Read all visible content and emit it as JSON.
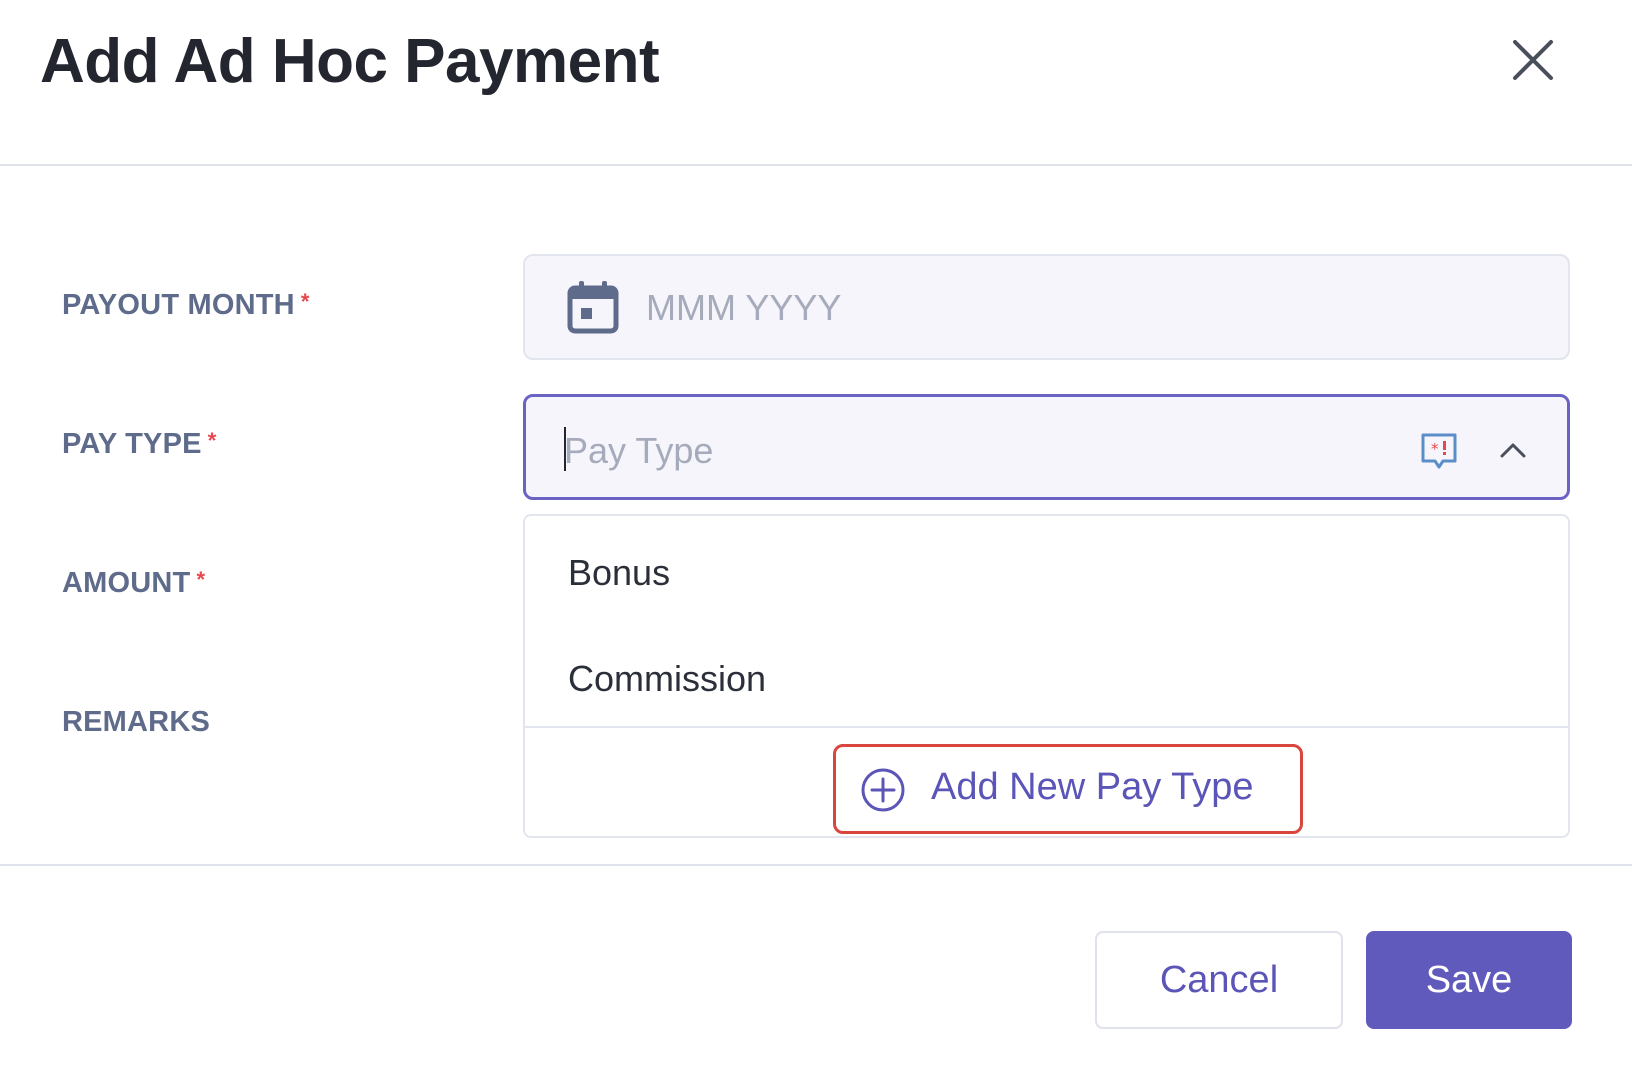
{
  "dialog": {
    "title": "Add Ad Hoc Payment"
  },
  "form": {
    "payout_month": {
      "label": "PAYOUT MONTH",
      "required_mark": "*",
      "placeholder": "MMM YYYY"
    },
    "pay_type": {
      "label": "PAY TYPE",
      "required_mark": "*",
      "placeholder": "Pay Type",
      "options": [
        "Bonus",
        "Commission"
      ],
      "add_new_label": "Add New Pay Type"
    },
    "amount": {
      "label": "AMOUNT",
      "required_mark": "*"
    },
    "remarks": {
      "label": "REMARKS"
    }
  },
  "footer": {
    "cancel_label": "Cancel",
    "save_label": "Save"
  },
  "colors": {
    "accent": "#5f5abb",
    "required": "#e5484d",
    "highlight_border": "#d9453f"
  },
  "icons": {
    "close": "close-icon",
    "calendar": "calendar-icon",
    "validation": "required-badge-icon",
    "chevron": "chevron-up-icon",
    "add": "plus-circle-icon"
  }
}
